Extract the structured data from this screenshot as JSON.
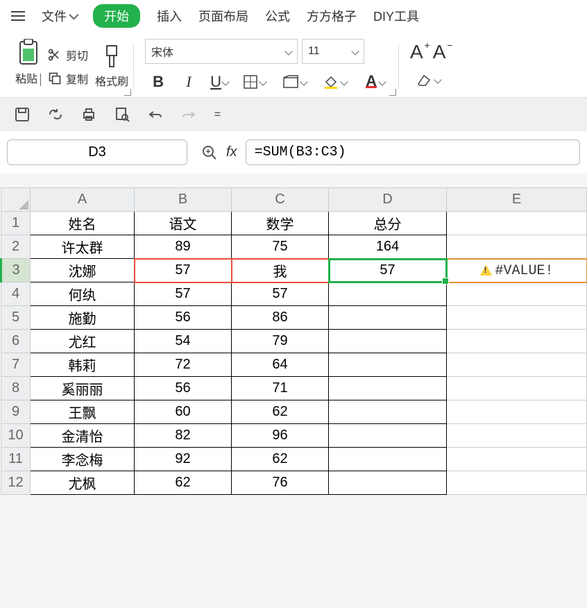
{
  "menu": {
    "file": "文件",
    "start": "开始",
    "insert": "插入",
    "layout": "页面布局",
    "formula": "公式",
    "ffgz": "方方格子",
    "diy": "DIY工具"
  },
  "ribbon": {
    "paste": "粘贴",
    "cut": "剪切",
    "copy": "复制",
    "format_painter": "格式刷",
    "font_name": "宋体",
    "font_size": "11"
  },
  "formula_bar": {
    "cell_ref": "D3",
    "formula": "=SUM(B3:C3)"
  },
  "columns": [
    "A",
    "B",
    "C",
    "D",
    "E"
  ],
  "headers": {
    "name": "姓名",
    "chinese": "语文",
    "math": "数学",
    "total": "总分"
  },
  "error_text": "#VALUE!",
  "rows": [
    {
      "n": 1,
      "name": "姓名",
      "c1": "语文",
      "c2": "数学",
      "c3": "总分"
    },
    {
      "n": 2,
      "name": "许太群",
      "c1": "89",
      "c2": "75",
      "c3": "164"
    },
    {
      "n": 3,
      "name": "沈娜",
      "c1": "57",
      "c2": "我",
      "c3": "57"
    },
    {
      "n": 4,
      "name": "何纨",
      "c1": "57",
      "c2": "57",
      "c3": ""
    },
    {
      "n": 5,
      "name": "施勤",
      "c1": "56",
      "c2": "86",
      "c3": ""
    },
    {
      "n": 6,
      "name": "尤红",
      "c1": "54",
      "c2": "79",
      "c3": ""
    },
    {
      "n": 7,
      "name": "韩莉",
      "c1": "72",
      "c2": "64",
      "c3": ""
    },
    {
      "n": 8,
      "name": "奚丽丽",
      "c1": "56",
      "c2": "71",
      "c3": ""
    },
    {
      "n": 9,
      "name": "王飘",
      "c1": "60",
      "c2": "62",
      "c3": ""
    },
    {
      "n": 10,
      "name": "金清怡",
      "c1": "82",
      "c2": "96",
      "c3": ""
    },
    {
      "n": 11,
      "name": "李念梅",
      "c1": "92",
      "c2": "62",
      "c3": ""
    },
    {
      "n": 12,
      "name": "尤枫",
      "c1": "62",
      "c2": "76",
      "c3": ""
    }
  ]
}
